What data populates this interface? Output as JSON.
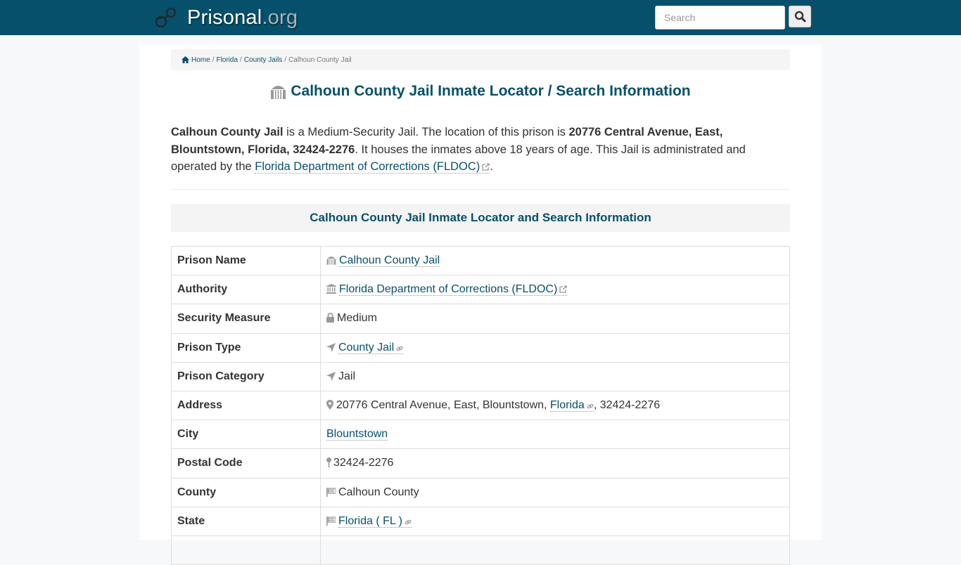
{
  "header": {
    "brand_name": "Prisonal",
    "brand_tld": ".org",
    "search_placeholder": "Search",
    "search_value": ""
  },
  "breadcrumb": {
    "items": [
      {
        "label": "Home",
        "icon": "home-icon",
        "link": true
      },
      {
        "label": "Florida",
        "link": true
      },
      {
        "label": "County Jails",
        "link": true
      },
      {
        "label": "Calhoun County Jail",
        "link": false
      }
    ],
    "separator": "/"
  },
  "page": {
    "title": "Calhoun County Jail Inmate Locator / Search Information",
    "title_icon": "prison-building-icon",
    "intro": {
      "name": "Calhoun County Jail",
      "text1": " is a Medium-Security Jail. The location of this prison is ",
      "address": "20776 Central Avenue, East, Blountstown, Florida, 32424-2276",
      "text2": ". It houses the inmates above 18 years of age. This Jail is administrated and operated by the ",
      "authority_link": "Florida Department of Corrections (FLDOC)",
      "text3": "."
    },
    "section_heading": "Calhoun County Jail Inmate Locator and Search Information"
  },
  "table": {
    "rows": [
      {
        "label": "Prison Name",
        "value": "Calhoun County Jail",
        "icon": "prison-building-icon",
        "link": true,
        "trail_icon": null
      },
      {
        "label": "Authority",
        "value": "Florida Department of Corrections (FLDOC)",
        "icon": "institution-icon",
        "link": true,
        "trail_icon": "external-link-icon"
      },
      {
        "label": "Security Measure",
        "value": "Medium",
        "icon": "lock-icon",
        "link": false,
        "trail_icon": null
      },
      {
        "label": "Prison Type",
        "value": "County Jail",
        "icon": "location-arrow-icon",
        "link": true,
        "trail_icon": "chain-link-icon"
      },
      {
        "label": "Prison Category",
        "value": "Jail",
        "icon": "location-arrow-icon",
        "link": false,
        "trail_icon": null
      },
      {
        "label": "Address",
        "value_prefix": "20776 Central Avenue, East, Blountstown, ",
        "value_link": "Florida",
        "value_suffix": ", 32424-2276",
        "icon": "map-marker-icon",
        "trail_icon": "chain-link-icon"
      },
      {
        "label": "City",
        "value": "Blountstown",
        "icon": null,
        "link": true,
        "trail_icon": null
      },
      {
        "label": "Postal Code",
        "value": "32424-2276",
        "icon": "map-pin-icon",
        "link": false,
        "trail_icon": null
      },
      {
        "label": "County",
        "value": "Calhoun County",
        "icon": "flag-icon",
        "link": false,
        "trail_icon": null
      },
      {
        "label": "State",
        "value": "Florida ( FL )",
        "icon": "flag-icon",
        "link": true,
        "trail_icon": "chain-link-icon"
      }
    ]
  },
  "colors": {
    "navbar": "#07506b",
    "link": "#07506b",
    "heading": "#07506b",
    "icon_gray": "#888888"
  }
}
